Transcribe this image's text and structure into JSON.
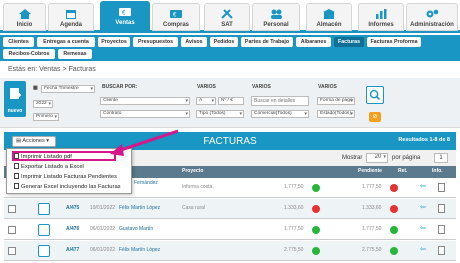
{
  "nav_tabs": [
    {
      "label": "Inicio",
      "icon": "home-icon"
    },
    {
      "label": "Agenda",
      "icon": "calendar-icon"
    },
    {
      "label": "Ventas",
      "icon": "sales-icon",
      "active": true
    },
    {
      "label": "Compras",
      "icon": "purchases-icon"
    },
    {
      "label": "SAT",
      "icon": "tools-icon"
    },
    {
      "label": "Personal",
      "icon": "staff-icon"
    },
    {
      "label": "Almacén",
      "icon": "warehouse-icon"
    },
    {
      "label": "Informes",
      "icon": "reports-icon"
    },
    {
      "label": "Administración",
      "icon": "gears-icon"
    }
  ],
  "sub_tabs": [
    "Clientes",
    "Entregas a cuenta",
    "Proyectos",
    "Presupuestos",
    "Avisos",
    "Pedidos",
    "Partes de Trabajo",
    "Albaranes",
    "Facturas",
    "Facturas Proforma",
    "Recibos-Cobros",
    "Remesas"
  ],
  "active_sub_tab": "Facturas",
  "breadcrumb": "Estás en: Ventas > Facturas",
  "new_button_label": "nuevo",
  "filters": {
    "date_type": "Fecha Trimestre",
    "year": "2022",
    "quarter": "Primero",
    "buscar_por_label": "BUSCAR POR:",
    "buscar_por_1": "Cliente",
    "buscar_por_2": "Contrato",
    "varios_label": "VARIOS",
    "varios_a": "A",
    "varios_num": "Nº / €",
    "varios_tipo": "Tipo (Todos)",
    "search_placeholder": "Buscar en detalles",
    "comercial": "Comercial(Todos)",
    "forma_pago": "Forma de pago",
    "estado": "Estado(Todos)"
  },
  "list": {
    "title": "FACTURAS",
    "results": "Resultados 1-8 de 8",
    "actions_label": "Acciones",
    "show_label": "Mostrar",
    "per_page_value": "20",
    "per_page_label": "por página",
    "page_number": "1"
  },
  "actions_menu": [
    "Imprimir Listado pdf",
    "Exportar Listado a Excel",
    "Imprimir Listado Facturas Pendientes",
    "Generar Excel incluyendo las Facturas"
  ],
  "columns": [
    "Proyecto",
    "Pendiente",
    "Ret.",
    "Info."
  ],
  "rows": [
    {
      "num": "",
      "date": "",
      "client": "Fernández",
      "project": "Informa costa",
      "amount": "1.777,50",
      "pending": "1.777,50",
      "status": "red"
    },
    {
      "num": "A/475",
      "date": "19/01/2022",
      "client": "Félix Martín López",
      "project": "Casa rural",
      "amount": "1.333,60",
      "pending": "1.333,60",
      "status": "red"
    },
    {
      "num": "A/476",
      "date": "06/01/2022",
      "client": "Gustavo Martín",
      "project": "",
      "amount": "1.777,50",
      "pending": "1.777,50",
      "status": "green"
    },
    {
      "num": "A/477",
      "date": "06/01/2022",
      "client": "Félix Martín López",
      "project": "",
      "amount": "2.775,50",
      "pending": "2.775,50",
      "status": "green"
    }
  ],
  "colors": {
    "accent": "#1a96c4",
    "highlight": "#d6168a",
    "header": "#5b7a8d"
  }
}
